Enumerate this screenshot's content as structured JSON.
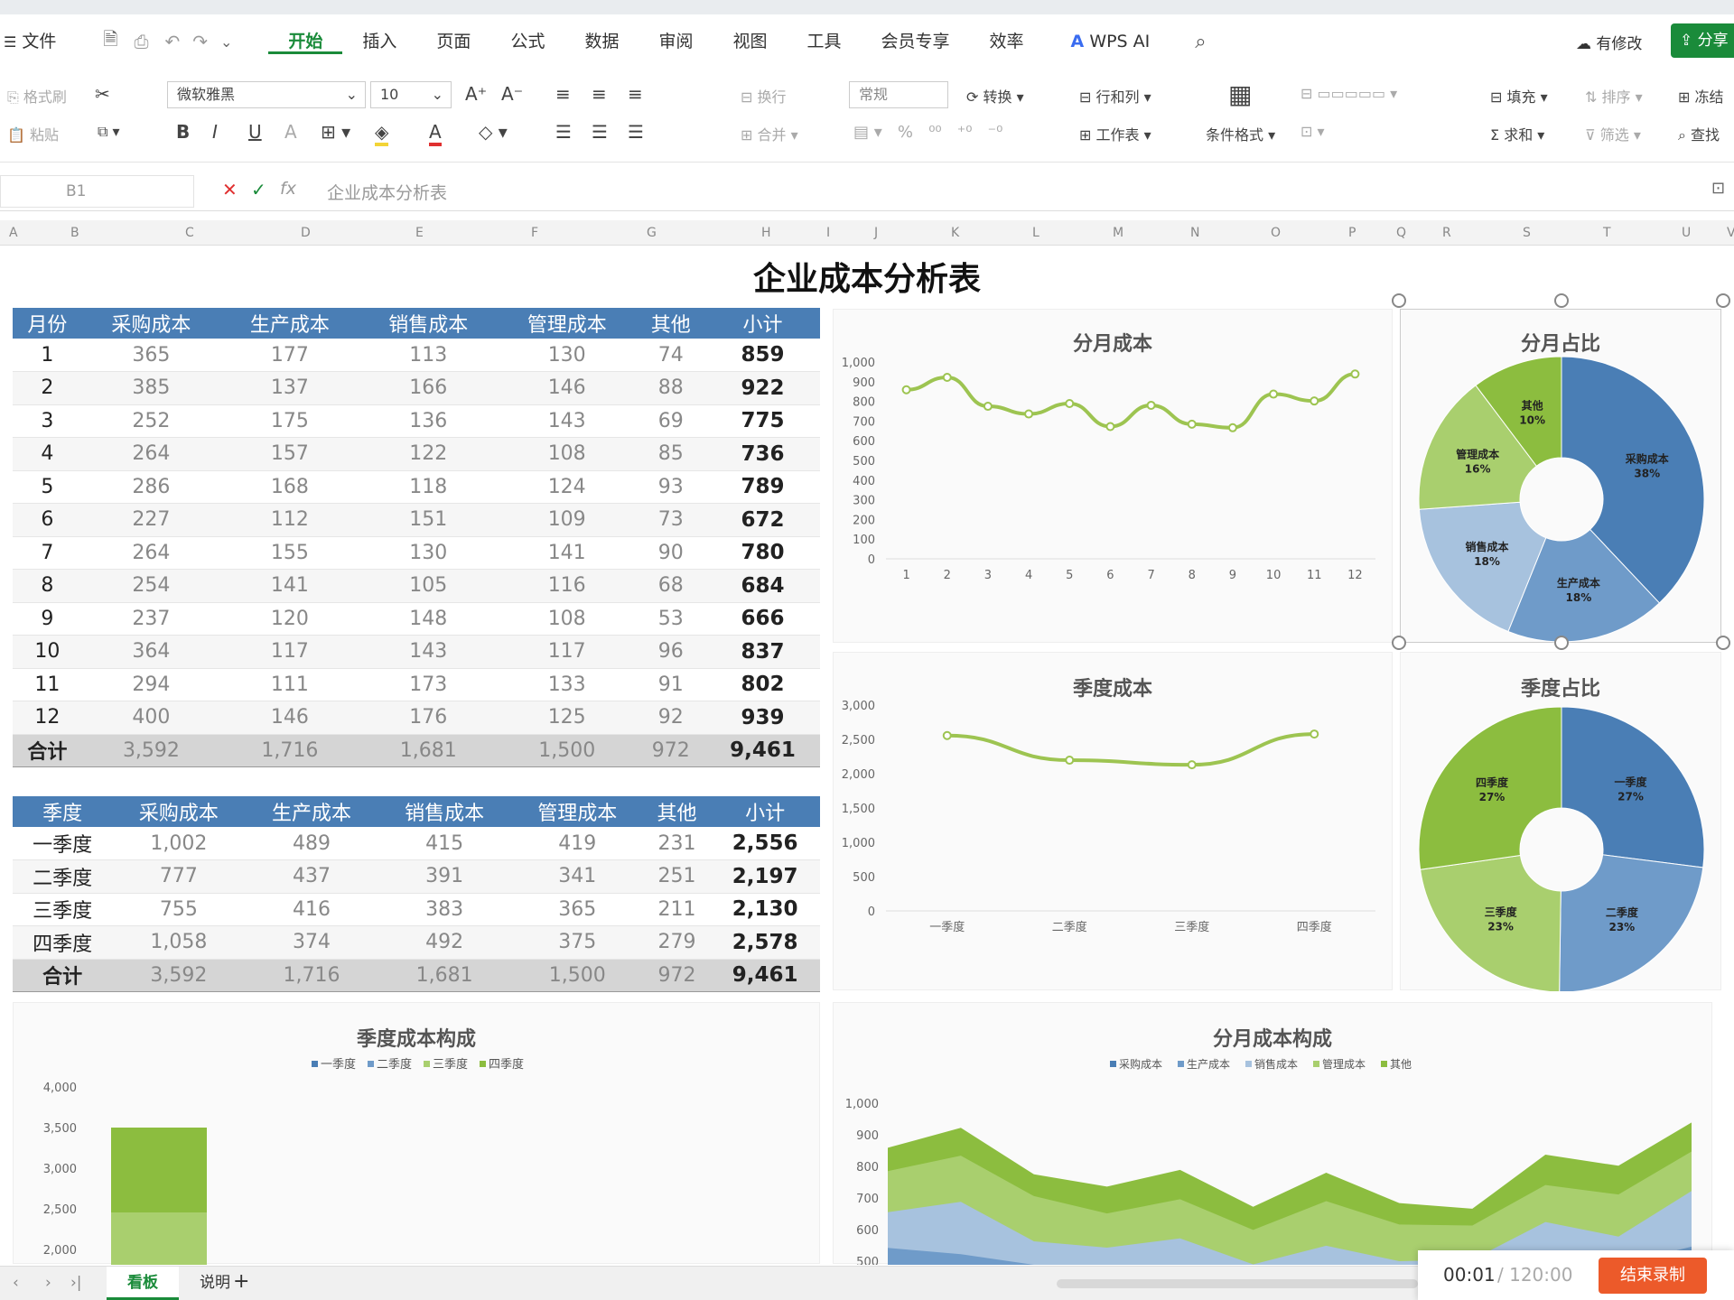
{
  "menu": {
    "file": "文件",
    "tabs": [
      "开始",
      "插入",
      "页面",
      "公式",
      "数据",
      "审阅",
      "视图",
      "工具",
      "会员专享",
      "效率"
    ],
    "wps_ai": "WPS AI",
    "modified": "有修改",
    "share": "分享"
  },
  "ribbon": {
    "format_painter": "格式刷",
    "paste": "粘贴",
    "font": "微软雅黑",
    "size": "10",
    "number_format": "常规",
    "convert": "转换",
    "row_col": "行和列",
    "worksheet": "工作表",
    "cond_format": "条件格式",
    "fill": "填充",
    "sort": "排序",
    "freeze": "冻结",
    "sum": "求和",
    "filter": "筛选",
    "find": "查找",
    "wrap": "换行",
    "merge": "合并"
  },
  "formula": {
    "cell": "B1",
    "fx": "fx",
    "content": "企业成本分析表"
  },
  "columns": [
    "A",
    "B",
    "C",
    "D",
    "E",
    "F",
    "G",
    "H",
    "I",
    "J",
    "K",
    "L",
    "M",
    "N",
    "O",
    "P",
    "Q",
    "R",
    "S",
    "T",
    "U",
    "V"
  ],
  "title": "企业成本分析表",
  "monthly": {
    "headers": [
      "月份",
      "采购成本",
      "生产成本",
      "销售成本",
      "管理成本",
      "其他",
      "小计"
    ],
    "rows": [
      [
        "1",
        "365",
        "177",
        "113",
        "130",
        "74",
        "859"
      ],
      [
        "2",
        "385",
        "137",
        "166",
        "146",
        "88",
        "922"
      ],
      [
        "3",
        "252",
        "175",
        "136",
        "143",
        "69",
        "775"
      ],
      [
        "4",
        "264",
        "157",
        "122",
        "108",
        "85",
        "736"
      ],
      [
        "5",
        "286",
        "168",
        "118",
        "124",
        "93",
        "789"
      ],
      [
        "6",
        "227",
        "112",
        "151",
        "109",
        "73",
        "672"
      ],
      [
        "7",
        "264",
        "155",
        "130",
        "141",
        "90",
        "780"
      ],
      [
        "8",
        "254",
        "141",
        "105",
        "116",
        "68",
        "684"
      ],
      [
        "9",
        "237",
        "120",
        "148",
        "108",
        "53",
        "666"
      ],
      [
        "10",
        "364",
        "117",
        "143",
        "117",
        "96",
        "837"
      ],
      [
        "11",
        "294",
        "111",
        "173",
        "133",
        "91",
        "802"
      ],
      [
        "12",
        "400",
        "146",
        "176",
        "125",
        "92",
        "939"
      ]
    ],
    "total": [
      "合计",
      "3,592",
      "1,716",
      "1,681",
      "1,500",
      "972",
      "9,461"
    ]
  },
  "quarterly": {
    "headers": [
      "季度",
      "采购成本",
      "生产成本",
      "销售成本",
      "管理成本",
      "其他",
      "小计"
    ],
    "rows": [
      [
        "一季度",
        "1,002",
        "489",
        "415",
        "419",
        "231",
        "2,556"
      ],
      [
        "二季度",
        "777",
        "437",
        "391",
        "341",
        "251",
        "2,197"
      ],
      [
        "三季度",
        "755",
        "416",
        "383",
        "365",
        "211",
        "2,130"
      ],
      [
        "四季度",
        "1,058",
        "374",
        "492",
        "375",
        "279",
        "2,578"
      ]
    ],
    "total": [
      "合计",
      "3,592",
      "1,716",
      "1,681",
      "1,500",
      "972",
      "9,461"
    ]
  },
  "chart_data": [
    {
      "type": "line",
      "title": "分月成本",
      "x": [
        "1",
        "2",
        "3",
        "4",
        "5",
        "6",
        "7",
        "8",
        "9",
        "10",
        "11",
        "12"
      ],
      "values": [
        859,
        922,
        775,
        736,
        789,
        672,
        780,
        684,
        666,
        837,
        802,
        939
      ],
      "ylim": [
        0,
        1000
      ],
      "yticks": [
        "1,000",
        "900",
        "800",
        "700",
        "600",
        "500",
        "400",
        "300",
        "200",
        "100",
        "0"
      ],
      "color": "#9dc451"
    },
    {
      "type": "pie",
      "title": "分月占比",
      "labels": [
        "采购成本",
        "生产成本",
        "销售成本",
        "管理成本",
        "其他"
      ],
      "pct_labels": [
        "38%",
        "18%",
        "18%",
        "16%",
        "10%"
      ],
      "values": [
        3592,
        1716,
        1681,
        1500,
        972
      ],
      "colors": [
        "#4a7eb5",
        "#6f9bc9",
        "#a7c2de",
        "#a9cf6e",
        "#8cbd3f"
      ]
    },
    {
      "type": "line",
      "title": "季度成本",
      "x": [
        "一季度",
        "二季度",
        "三季度",
        "四季度"
      ],
      "values": [
        2556,
        2197,
        2130,
        2578
      ],
      "ylim": [
        0,
        3000
      ],
      "yticks": [
        "3,000",
        "2,500",
        "2,000",
        "1,500",
        "1,000",
        "500",
        "0"
      ],
      "color": "#9dc451"
    },
    {
      "type": "pie",
      "title": "季度占比",
      "labels": [
        "一季度",
        "二季度",
        "三季度",
        "四季度"
      ],
      "pct_labels": [
        "27%",
        "23%",
        "23%",
        "27%"
      ],
      "values": [
        2556,
        2197,
        2130,
        2578
      ],
      "colors": [
        "#4a7eb5",
        "#6f9bc9",
        "#a9cf6e",
        "#8cbd3f"
      ]
    },
    {
      "type": "bar",
      "title": "季度成本构成",
      "legend": [
        "一季度",
        "二季度",
        "三季度",
        "四季度"
      ],
      "yticks": [
        "4,000",
        "3,500",
        "3,000",
        "2,500",
        "2,000"
      ]
    },
    {
      "type": "area",
      "title": "分月成本构成",
      "legend": [
        "采购成本",
        "生产成本",
        "销售成本",
        "管理成本",
        "其他"
      ],
      "yticks": [
        "1,000",
        "900",
        "800",
        "700",
        "600",
        "500"
      ]
    }
  ],
  "sheettabs": [
    "看板",
    "说明"
  ],
  "recorder": {
    "time": "00:01",
    "total": "/ 120:00",
    "stop": "结束录制"
  }
}
